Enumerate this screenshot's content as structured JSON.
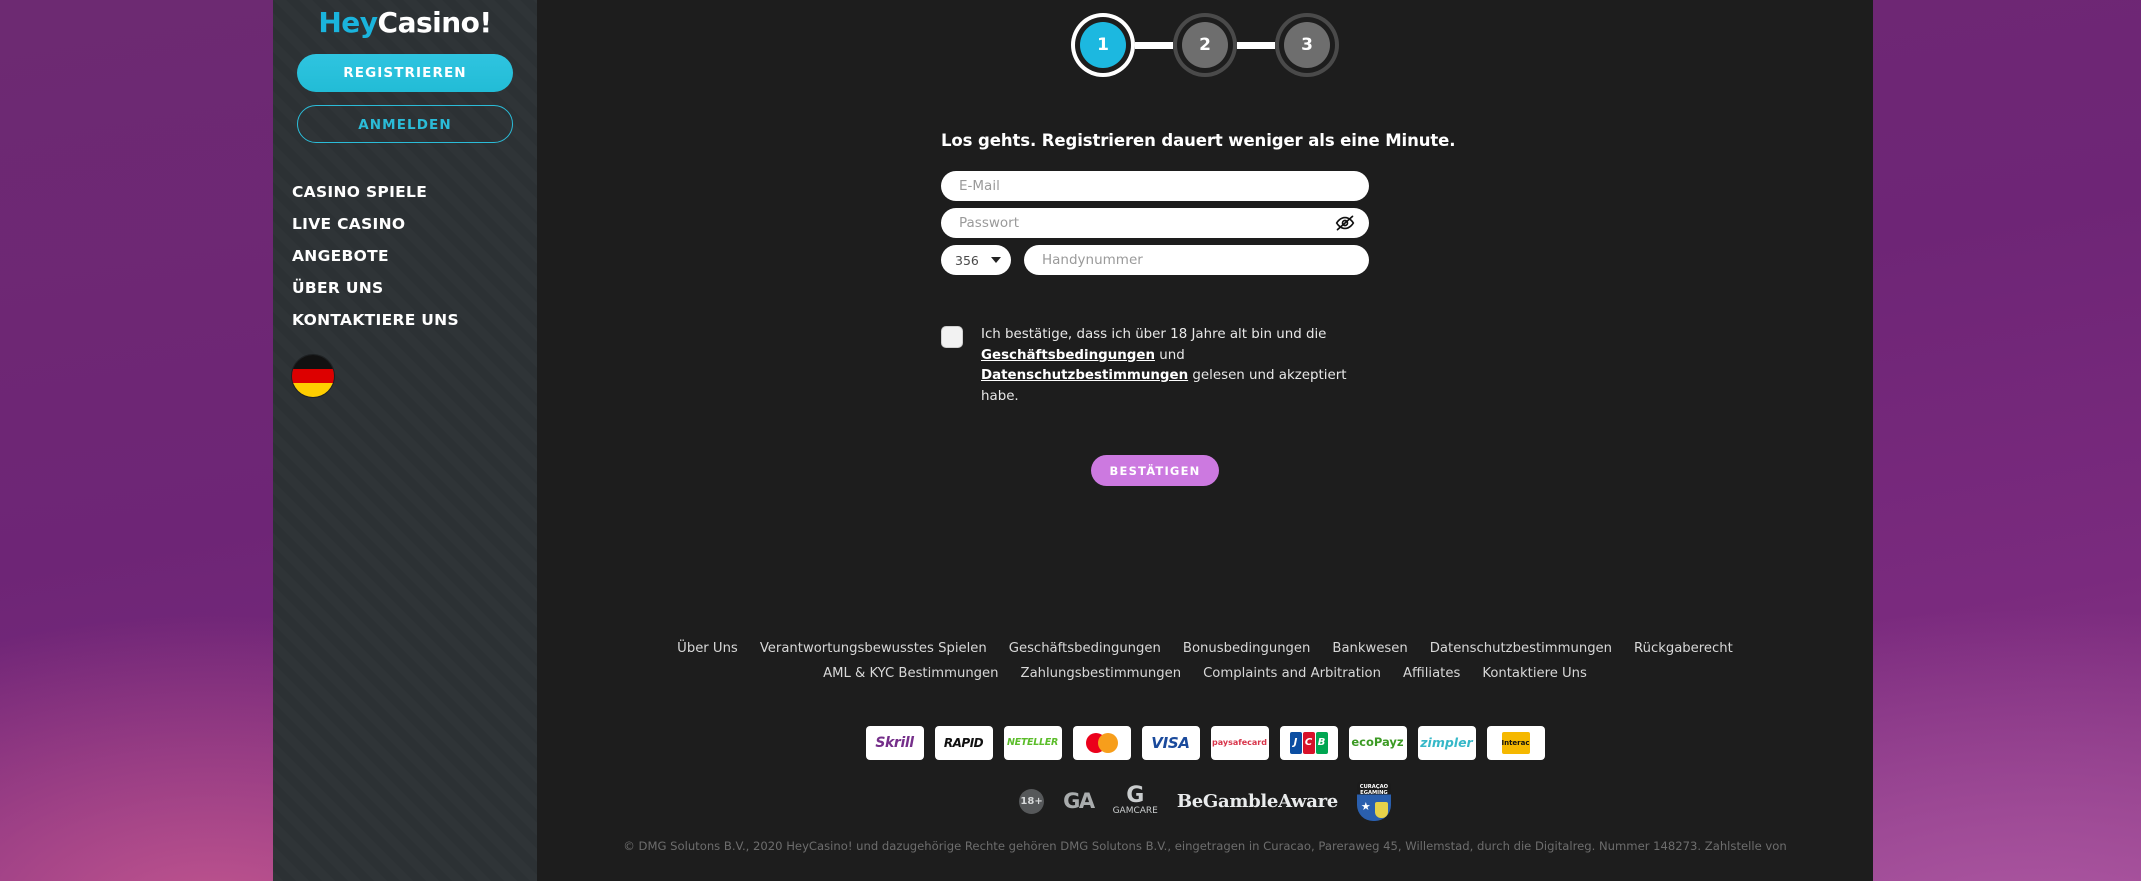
{
  "brand": {
    "hey": "Hey",
    "casino": "Casino!"
  },
  "sidebar": {
    "register_label": "REGISTRIEREN",
    "login_label": "ANMELDEN",
    "nav": [
      {
        "label": "CASINO SPIELE"
      },
      {
        "label": "LIVE CASINO"
      },
      {
        "label": "ANGEBOTE"
      },
      {
        "label": "ÜBER UNS"
      },
      {
        "label": "KONTAKTIERE UNS"
      }
    ],
    "language_flag": "de-flag-icon"
  },
  "steps": [
    {
      "number": "1",
      "state": "active"
    },
    {
      "number": "2",
      "state": "idle"
    },
    {
      "number": "3",
      "state": "idle"
    }
  ],
  "form": {
    "heading": "Los gehts. Registrieren dauert weniger als eine Minute.",
    "email": {
      "value": "",
      "placeholder": "E-Mail"
    },
    "password": {
      "value": "",
      "placeholder": "Passwort",
      "toggle_icon": "eye-off-icon"
    },
    "country_code": {
      "value": "356",
      "caret_icon": "chevron-down-icon"
    },
    "phone": {
      "value": "",
      "placeholder": "Handynummer"
    },
    "terms": {
      "checked": false,
      "part1": "Ich bestätige, dass ich über 18 Jahre alt bin und die ",
      "link1": "Geschäftsbedingungen",
      "part2": " und ",
      "link2": "Datenschutzbestimmungen",
      "part3": " gelesen und akzeptiert habe."
    },
    "submit_label": "BESTÄTIGEN"
  },
  "footer": {
    "links": [
      "Über Uns",
      "Verantwortungsbewusstes Spielen",
      "Geschäftsbedingungen",
      "Bonusbedingungen",
      "Bankwesen",
      "Datenschutzbestimmungen",
      "Rückgaberecht",
      "AML & KYC Bestimmungen",
      "Zahlungsbestimmungen",
      "Complaints and Arbitration",
      "Affiliates",
      "Kontaktiere Uns"
    ],
    "payments": [
      {
        "name": "Skrill",
        "label": "Skrill"
      },
      {
        "name": "Rapid Transfer",
        "label": "RAPID"
      },
      {
        "name": "Neteller",
        "label": "NETELLER"
      },
      {
        "name": "Mastercard",
        "label": ""
      },
      {
        "name": "VISA",
        "label": "VISA"
      },
      {
        "name": "paysafecard",
        "label": "paysafecard"
      },
      {
        "name": "JCB",
        "label": "JCB"
      },
      {
        "name": "ecoPayz",
        "label": "ecoPayz"
      },
      {
        "name": "Zimpler",
        "label": "zimpler"
      },
      {
        "name": "Interac",
        "label": "Interac"
      }
    ],
    "badges": [
      {
        "name": "18-plus",
        "label": "18+"
      },
      {
        "name": "gamblers-anonymous",
        "label": "GA"
      },
      {
        "name": "gamcare",
        "label": "GAMCARE"
      },
      {
        "name": "begambleaware",
        "label": "BeGambleAware"
      },
      {
        "name": "curacao-egaming",
        "label": "CURAÇAO EGAMING"
      }
    ],
    "copyright": "© DMG Solutons B.V., 2020 HeyCasino! und dazugehörige Rechte gehören DMG Solutons B.V., eingetragen in Curacao, Pareraweg 45, Willemstad, durch die Digitalreg. Nummer 148273. Zahlstelle von"
  },
  "colors": {
    "accent_cyan": "#1cb8e0",
    "accent_purple": "#cc79e0",
    "sidebar_bg": "#2c3134",
    "main_bg": "#1d1d1d"
  }
}
